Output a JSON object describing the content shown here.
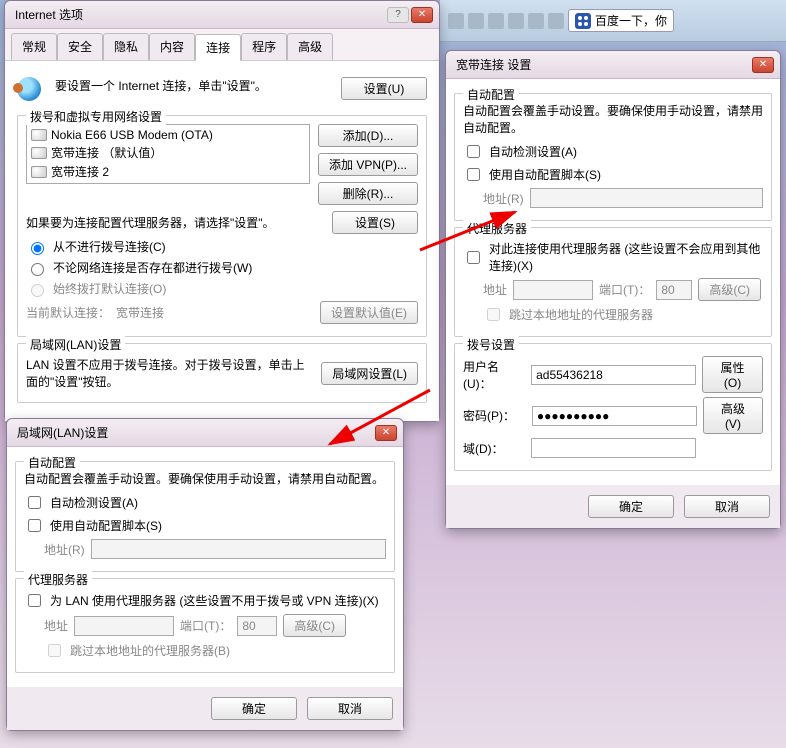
{
  "browser": {
    "baidu_label": "百度一下，你",
    "icons": [
      "home",
      "star",
      "favorites",
      "add",
      "print",
      "tools",
      "menu"
    ]
  },
  "internet_options": {
    "title": "Internet 选项",
    "tabs": [
      "常规",
      "安全",
      "隐私",
      "内容",
      "连接",
      "程序",
      "高级"
    ],
    "active_tab": 4,
    "setup_text1": "要设置一个 Internet 连接，单击\"设置\"。",
    "setup_btn": "设置(U)",
    "dialup_group": "拨号和虚拟专用网络设置",
    "connections": [
      "Nokia E66 USB Modem (OTA)",
      "宽带连接 （默认值）",
      "宽带连接 2"
    ],
    "add_btn": "添加(D)...",
    "add_vpn_btn": "添加 VPN(P)...",
    "remove_btn": "删除(R)...",
    "proxy_note": "如果要为连接配置代理服务器，请选择\"设置\"。",
    "settings_btn": "设置(S)",
    "radio_never": "从不进行拨号连接(C)",
    "radio_cond": "不论网络连接是否存在都进行拨号(W)",
    "radio_always": "始终拨打默认连接(O)",
    "default_label": "当前默认连接：",
    "default_value": "宽带连接",
    "set_default_btn": "设置默认值(E)",
    "lan_group": "局域网(LAN)设置",
    "lan_note": "LAN 设置不应用于拨号连接。对于拨号设置，单击上面的\"设置\"按钮。",
    "lan_btn": "局域网设置(L)"
  },
  "broadband_settings": {
    "title": "宽带连接 设置",
    "auto_group": "自动配置",
    "auto_note": "自动配置会覆盖手动设置。要确保使用手动设置，请禁用自动配置。",
    "auto_detect": "自动检测设置(A)",
    "auto_script": "使用自动配置脚本(S)",
    "address_label": "地址(R)",
    "proxy_group": "代理服务器",
    "proxy_use": "对此连接使用代理服务器 (这些设置不会应用到其他连接)(X)",
    "proxy_addr": "地址",
    "proxy_port": "端口(T)：",
    "port_value": "80",
    "advanced_btn": "高级(C)",
    "bypass_local": "跳过本地地址的代理服务器",
    "dial_group": "拨号设置",
    "user_label": "用户名(U)：",
    "user_value": "ad55436218",
    "prop_btn": "属性(O)",
    "pass_label": "密码(P)：",
    "pass_value": "●●●●●●●●●●",
    "adv2_btn": "高级(V)",
    "domain_label": "域(D)：",
    "ok_btn": "确定",
    "cancel_btn": "取消"
  },
  "lan_settings": {
    "title": "局域网(LAN)设置",
    "auto_group": "自动配置",
    "auto_note": "自动配置会覆盖手动设置。要确保使用手动设置，请禁用自动配置。",
    "auto_detect": "自动检测设置(A)",
    "auto_script": "使用自动配置脚本(S)",
    "address_label": "地址(R)",
    "proxy_group": "代理服务器",
    "proxy_use": "为 LAN 使用代理服务器 (这些设置不用于拨号或 VPN 连接)(X)",
    "proxy_addr": "地址",
    "proxy_port": "端口(T)：",
    "port_value": "80",
    "advanced_btn": "高级(C)",
    "bypass_local": "跳过本地地址的代理服务器(B)",
    "ok_btn": "确定",
    "cancel_btn": "取消"
  }
}
